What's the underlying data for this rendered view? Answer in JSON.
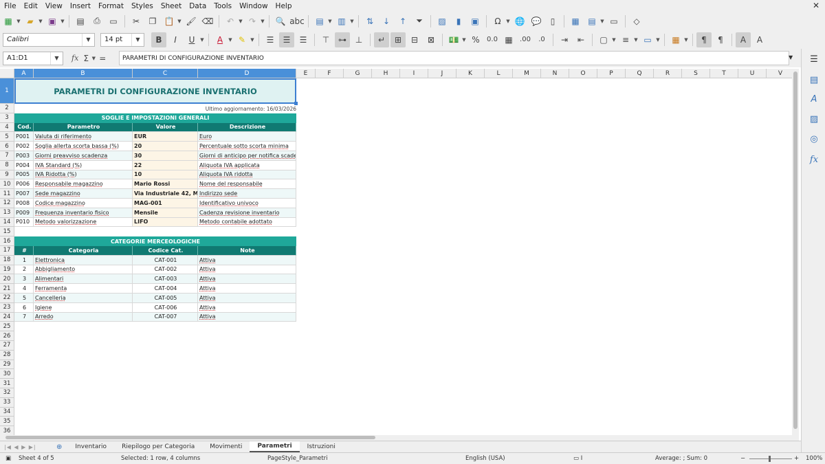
{
  "menu": [
    "File",
    "Edit",
    "View",
    "Insert",
    "Format",
    "Styles",
    "Sheet",
    "Data",
    "Tools",
    "Window",
    "Help"
  ],
  "toolbar": {
    "font_name": "Calibri",
    "font_size": "14 pt"
  },
  "formula": {
    "name_box": "A1:D1",
    "content": "PARAMETRI DI CONFIGURAZIONE INVENTARIO"
  },
  "columns": [
    "A",
    "B",
    "C",
    "D",
    "E",
    "F",
    "G",
    "H",
    "I",
    "J",
    "K",
    "L",
    "M",
    "N",
    "O",
    "P",
    "Q",
    "R",
    "S",
    "T",
    "U",
    "V"
  ],
  "rows": [
    "1",
    "2",
    "3",
    "4",
    "5",
    "6",
    "7",
    "8",
    "9",
    "10",
    "11",
    "12",
    "13",
    "14",
    "15",
    "16",
    "17",
    "18",
    "19",
    "20",
    "21",
    "22",
    "23",
    "24",
    "25",
    "26",
    "27",
    "28",
    "29",
    "30",
    "31",
    "32",
    "33",
    "34",
    "35",
    "36"
  ],
  "sheet": {
    "title": "PARAMETRI DI CONFIGURAZIONE INVENTARIO",
    "last_update": "Ultimo aggiornamento: 16/03/2026",
    "section1": {
      "title": "SOGLIE E IMPOSTAZIONI GENERALI",
      "headers": [
        "Cod.",
        "Parametro",
        "Valore",
        "Descrizione"
      ],
      "rows": [
        {
          "cod": "P001",
          "param": "Valuta di riferimento",
          "val": "EUR",
          "desc": "Euro"
        },
        {
          "cod": "P002",
          "param": "Soglia allerta scorta bassa (%)",
          "val": "20",
          "desc": "Percentuale sotto scorta minima"
        },
        {
          "cod": "P003",
          "param": "Giorni preavviso scadenza",
          "val": "30",
          "desc": "Giorni di anticipo per notifica scadenza"
        },
        {
          "cod": "P004",
          "param": "IVA Standard (%)",
          "val": "22",
          "desc": "Aliquota IVA applicata"
        },
        {
          "cod": "P005",
          "param": "IVA Ridotta (%)",
          "val": "10",
          "desc": "Aliquota IVA ridotta"
        },
        {
          "cod": "P006",
          "param": "Responsabile magazzino",
          "val": "Mario Rossi",
          "desc": "Nome del responsabile"
        },
        {
          "cod": "P007",
          "param": "Sede magazzino",
          "val": "Via Industriale 42, Milano",
          "desc": "Indirizzo sede"
        },
        {
          "cod": "P008",
          "param": "Codice magazzino",
          "val": "MAG-001",
          "desc": "Identificativo univoco"
        },
        {
          "cod": "P009",
          "param": "Frequenza inventario fisico",
          "val": "Mensile",
          "desc": "Cadenza revisione inventario"
        },
        {
          "cod": "P010",
          "param": "Metodo valorizzazione",
          "val": "LIFO",
          "desc": "Metodo contabile adottato"
        }
      ]
    },
    "section2": {
      "title": "CATEGORIE MERCEOLOGICHE",
      "headers": [
        "#",
        "Categoria",
        "Codice Cat.",
        "Note"
      ],
      "rows": [
        {
          "n": "1",
          "cat": "Elettronica",
          "code": "CAT-001",
          "note": "Attiva"
        },
        {
          "n": "2",
          "cat": "Abbigliamento",
          "code": "CAT-002",
          "note": "Attiva"
        },
        {
          "n": "3",
          "cat": "Alimentari",
          "code": "CAT-003",
          "note": "Attiva"
        },
        {
          "n": "4",
          "cat": "Ferramenta",
          "code": "CAT-004",
          "note": "Attiva"
        },
        {
          "n": "5",
          "cat": "Cancelleria",
          "code": "CAT-005",
          "note": "Attiva"
        },
        {
          "n": "6",
          "cat": "Igiene",
          "code": "CAT-006",
          "note": "Attiva"
        },
        {
          "n": "7",
          "cat": "Arredo",
          "code": "CAT-007",
          "note": "Attiva"
        }
      ]
    }
  },
  "tabs": [
    "Inventario",
    "Riepilogo per Categoria",
    "Movimenti",
    "Parametri",
    "Istruzioni"
  ],
  "active_tab": "Parametri",
  "status": {
    "sheet": "Sheet 4 of 5",
    "selection": "Selected: 1 row, 4 columns",
    "page_style": "PageStyle_Parametri",
    "language": "English (USA)",
    "sum": "Average: ; Sum: 0",
    "zoom": "100%"
  },
  "colors": {
    "accent": "#1fa89a",
    "header_dark": "#107a72",
    "title_bg": "#dff2f2",
    "selection": "#4a90d9"
  }
}
